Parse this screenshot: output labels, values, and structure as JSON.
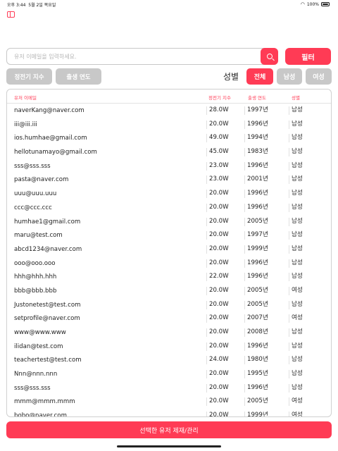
{
  "status_bar": {
    "time": "오후 3:44",
    "date": "5월 2일 목요일",
    "battery": "100%"
  },
  "icons": {
    "sidebar": "sidebar-icon",
    "search": "search-icon",
    "wifi": "wifi-icon",
    "battery": "battery-icon"
  },
  "colors": {
    "accent": "#ff3b55",
    "inactive": "#c8c8c8"
  },
  "search": {
    "placeholder": "유저 이메일을 입력하세요.",
    "value": ""
  },
  "filter_label": "필터",
  "sort_buttons": {
    "power": "정전기 지수",
    "year": "출생 연도"
  },
  "gender_filter": {
    "label": "성별",
    "all": "전체",
    "male": "남성",
    "female": "여성",
    "selected": "전체"
  },
  "table": {
    "headers": {
      "email": "유저 이메일",
      "power": "정전기 지수",
      "year": "출생 연도",
      "gender": "성별"
    },
    "rows": [
      {
        "email": "naverKang@naver.com",
        "power": "28.0W",
        "year": "1997년",
        "gender": "남성"
      },
      {
        "email": "iii@iii.iii",
        "power": "20.0W",
        "year": "1996년",
        "gender": "남성"
      },
      {
        "email": "ios.humhae@gmail.com",
        "power": "49.0W",
        "year": "1994년",
        "gender": "남성"
      },
      {
        "email": "hellotunamayo@gmail.com",
        "power": "45.0W",
        "year": "1983년",
        "gender": "남성"
      },
      {
        "email": "sss@sss.sss",
        "power": "23.0W",
        "year": "1996년",
        "gender": "남성"
      },
      {
        "email": "pasta@naver.com",
        "power": "23.0W",
        "year": "2001년",
        "gender": "남성"
      },
      {
        "email": "uuu@uuu.uuu",
        "power": "20.0W",
        "year": "1996년",
        "gender": "남성"
      },
      {
        "email": "ccc@ccc.ccc",
        "power": "20.0W",
        "year": "1996년",
        "gender": "남성"
      },
      {
        "email": "humhae1@gmail.com",
        "power": "20.0W",
        "year": "2005년",
        "gender": "남성"
      },
      {
        "email": "maru@test.com",
        "power": "20.0W",
        "year": "1997년",
        "gender": "남성"
      },
      {
        "email": "abcd1234@naver.com",
        "power": "20.0W",
        "year": "1999년",
        "gender": "남성"
      },
      {
        "email": "ooo@ooo.ooo",
        "power": "20.0W",
        "year": "1996년",
        "gender": "남성"
      },
      {
        "email": "hhh@hhh.hhh",
        "power": "22.0W",
        "year": "1996년",
        "gender": "남성"
      },
      {
        "email": "bbb@bbb.bbb",
        "power": "20.0W",
        "year": "2005년",
        "gender": "여성"
      },
      {
        "email": "Justonetest@test.com",
        "power": "20.0W",
        "year": "2005년",
        "gender": "남성"
      },
      {
        "email": "setprofile@naver.com",
        "power": "20.0W",
        "year": "2007년",
        "gender": "여성"
      },
      {
        "email": "www@www.www",
        "power": "20.0W",
        "year": "2008년",
        "gender": "남성"
      },
      {
        "email": "ilidan@test.com",
        "power": "20.0W",
        "year": "1996년",
        "gender": "남성"
      },
      {
        "email": "teachertest@test.com",
        "power": "24.0W",
        "year": "1980년",
        "gender": "남성"
      },
      {
        "email": "Nnn@nnn.nnn",
        "power": "20.0W",
        "year": "1995년",
        "gender": "남성"
      },
      {
        "email": "sss@sss.sss",
        "power": "20.0W",
        "year": "1996년",
        "gender": "남성"
      },
      {
        "email": "mmm@mmm.mmm",
        "power": "20.0W",
        "year": "2005년",
        "gender": "여성"
      },
      {
        "email": "bobo@naver.com",
        "power": "20.0W",
        "year": "1999년",
        "gender": "여성"
      }
    ]
  },
  "action_button": "선택한 유저 제재/관리"
}
